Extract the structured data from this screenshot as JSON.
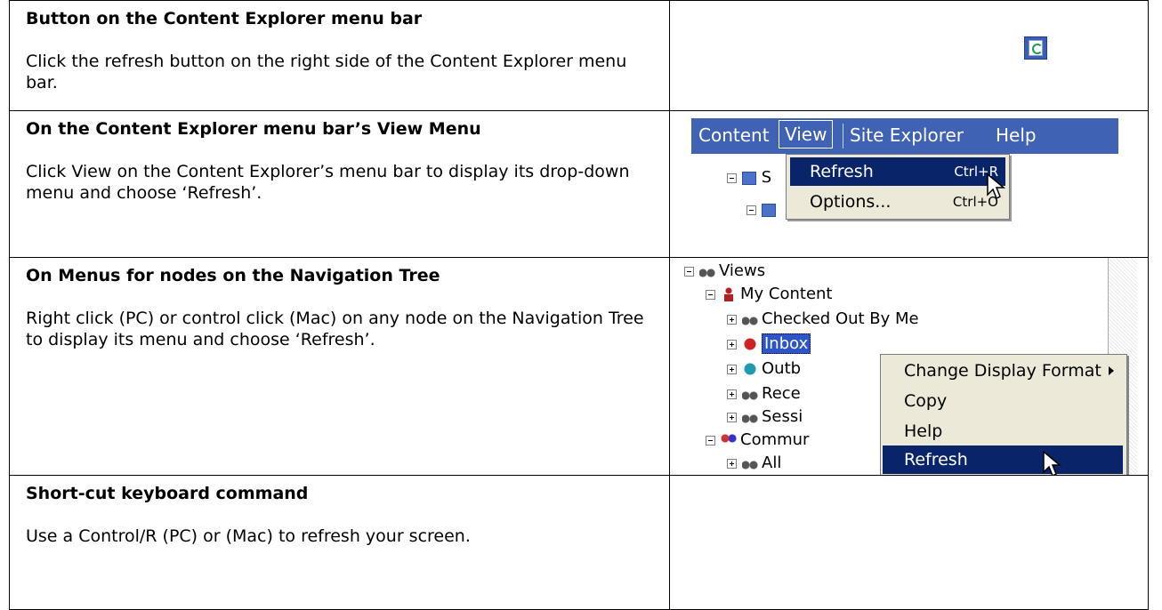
{
  "rows": [
    {
      "title": "Button on the Content Explorer menu bar",
      "body": "Click the refresh button on the right side of the Content Explorer menu bar."
    },
    {
      "title": "On the Content Explorer menu bar’s View Menu",
      "body": "Click View on the Content Explorer’s menu bar to display its drop-down menu and choose ‘Refresh’."
    },
    {
      "title": "On Menus for nodes on the Navigation Tree",
      "body": "Right click (PC) or control click (Mac) on any node on the Navigation Tree to display its menu and choose ‘Refresh’."
    },
    {
      "title": "Short-cut keyboard command",
      "body": "Use a Control/R (PC) or (Mac) to refresh your screen."
    }
  ],
  "menubar": {
    "items": [
      "Content",
      "View",
      "Site Explorer",
      "Help"
    ],
    "tree_partial": "S"
  },
  "view_menu": {
    "items": [
      {
        "label": "Refresh",
        "shortcut": "Ctrl+R"
      },
      {
        "label": "Options...",
        "shortcut": "Ctrl+O"
      }
    ]
  },
  "nav_tree": {
    "views": "Views",
    "my_content": "My Content",
    "checked_out": "Checked Out By Me",
    "inbox": "Inbox",
    "outbox": "Outb",
    "recent": "Rece",
    "sessions": "Sessi",
    "communities": "Commur",
    "all": "All"
  },
  "context_menu": {
    "items": [
      "Change Display Format",
      "Copy",
      "Help",
      "Refresh"
    ]
  },
  "colors": {
    "menubar_bg": "#3f62b5",
    "highlight": "#0a246a",
    "menu_bg": "#ece9d8"
  }
}
